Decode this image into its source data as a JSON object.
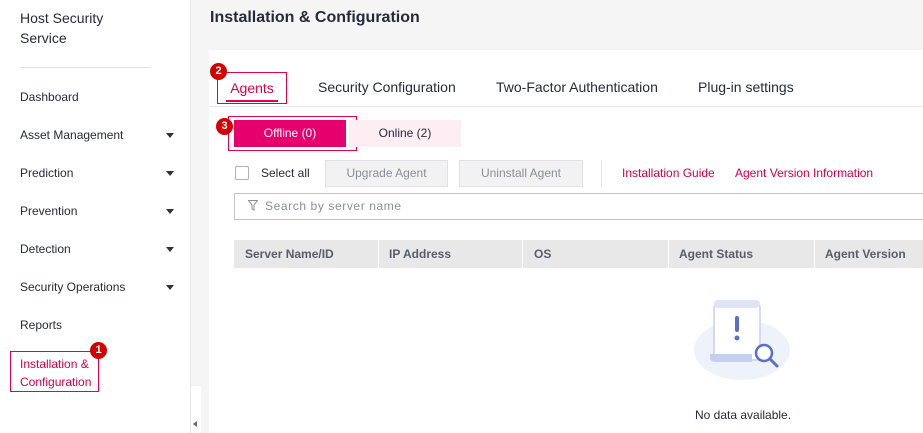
{
  "sidebar": {
    "title": "Host Security Service",
    "items": [
      {
        "label": "Dashboard",
        "expandable": false
      },
      {
        "label": "Asset Management",
        "expandable": true
      },
      {
        "label": "Prediction",
        "expandable": true
      },
      {
        "label": "Prevention",
        "expandable": true
      },
      {
        "label": "Detection",
        "expandable": true
      },
      {
        "label": "Security Operations",
        "expandable": true
      },
      {
        "label": "Reports",
        "expandable": false
      }
    ],
    "active_item": {
      "label_line1": "Installation &",
      "label_line2": "Configuration"
    },
    "badge": "1"
  },
  "header": {
    "title": "Installation & Configuration"
  },
  "tabs": {
    "badge": "2",
    "items": [
      "Agents",
      "Security Configuration",
      "Two-Factor Authentication",
      "Plug-in settings"
    ],
    "active": "Agents"
  },
  "subtabs": {
    "badge": "3",
    "offline": "Offline (0)",
    "online": "Online (2)"
  },
  "toolbar": {
    "select_all": "Select all",
    "upgrade": "Upgrade Agent",
    "uninstall": "Uninstall Agent",
    "install_guide": "Installation Guide",
    "version_info": "Agent Version Information"
  },
  "search": {
    "placeholder": "Search by server name"
  },
  "table": {
    "columns": [
      "Server Name/ID",
      "IP Address",
      "OS",
      "Agent Status",
      "Agent Version"
    ],
    "empty_text": "No data available."
  },
  "colors": {
    "accent": "#e6006e",
    "highlight_border": "#e6004c",
    "badge": "#d40000"
  }
}
